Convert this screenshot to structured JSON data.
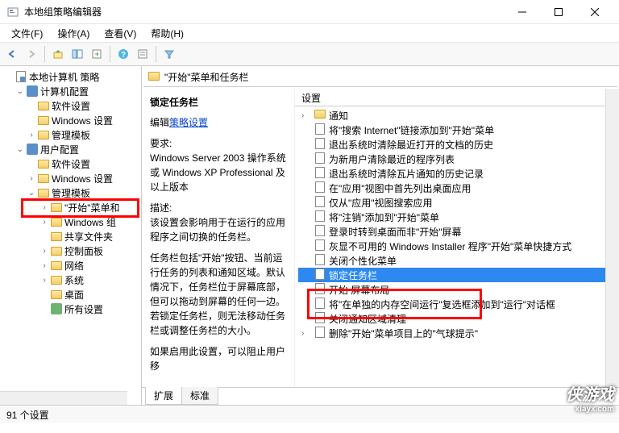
{
  "window": {
    "title": "本地组策略编辑器"
  },
  "menu": {
    "file": "文件(F)",
    "action": "操作(A)",
    "view": "查看(V)",
    "help": "帮助(H)"
  },
  "tree": {
    "root": "本地计算机 策略",
    "computer_config": "计算机配置",
    "software_settings1": "软件设置",
    "windows_settings1": "Windows 设置",
    "admin_templates1": "管理模板",
    "user_config": "用户配置",
    "software_settings2": "软件设置",
    "windows_settings2": "Windows 设置",
    "admin_templates2": "管理模板",
    "start_menu": "\"开始\"菜单和",
    "windows_comp": "Windows 组",
    "shared_folders": "共享文件夹",
    "control_panel": "控制面板",
    "network": "网络",
    "system": "系统",
    "desktop": "桌面",
    "all_settings": "所有设置"
  },
  "path": {
    "current": "\"开始\"菜单和任务栏"
  },
  "desc": {
    "title": "锁定任务栏",
    "edit_link": "策略设置",
    "edit_prefix": "编辑",
    "req_label": "要求:",
    "req_text": "Windows Server 2003 操作系统或 Windows XP Professional 及以上版本",
    "desc_label": "描述:",
    "desc_text": "该设置会影响用于在运行的应用程序之间切换的任务栏。",
    "para2": "任务栏包括\"开始\"按钮、当前运行任务的列表和通知区域。默认情况下，任务栏位于屏幕底部，但可以拖动到屏幕的任何一边。若锁定任务栏，则无法移动任务栏或调整任务栏的大小。",
    "para3_prefix": "如果启用此设置，可以阻止用户移"
  },
  "list": {
    "header": "设置",
    "items": [
      "通知",
      "将\"搜索 Internet\"链接添加到\"开始\"菜单",
      "退出系统时清除最近打开的文档的历史",
      "为新用户清除最近的程序列表",
      "退出系统时清除瓦片通知的历史记录",
      "在\"应用\"视图中首先列出桌面应用",
      "仅从\"应用\"视图搜索应用",
      "将\"注销\"添加到\"开始\"菜单",
      "登录时转到桌面而非\"开始\"屏幕",
      "灰显不可用的 Windows Installer 程序\"开始\"菜单快捷方式",
      "关闭个性化菜单",
      "锁定任务栏",
      "开始 屏幕布局",
      "将\"在单独的内存空间运行\"复选框添加到\"运行\"对话框",
      "关闭通知区域清理",
      "删除\"开始\"菜单项目上的\"气球提示\""
    ]
  },
  "tabs": {
    "extended": "扩展",
    "standard": "标准"
  },
  "status": {
    "count": "91 个设置"
  },
  "watermark": {
    "main": "侠游戏",
    "sub": "xiayx.com"
  }
}
